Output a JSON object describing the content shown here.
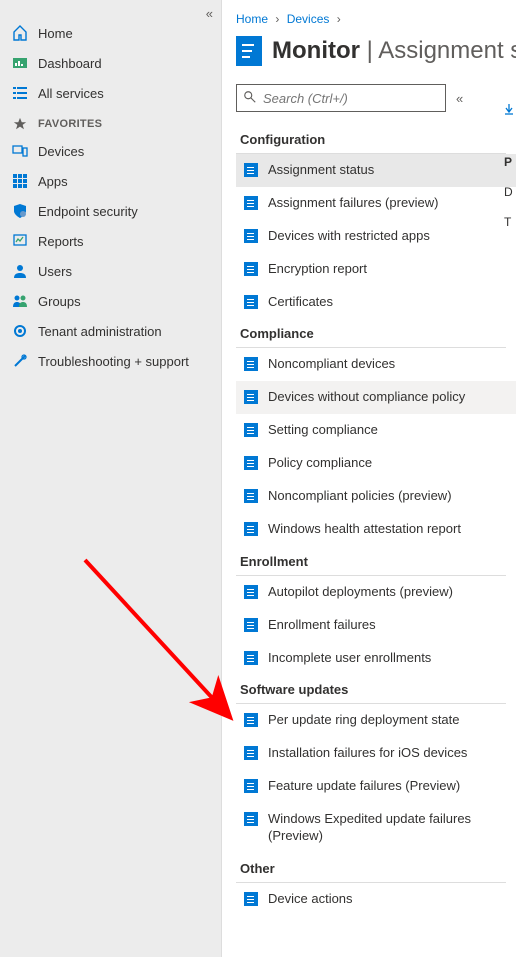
{
  "breadcrumb": {
    "home": "Home",
    "devices": "Devices"
  },
  "sidebar": {
    "items": [
      {
        "label": "Home"
      },
      {
        "label": "Dashboard"
      },
      {
        "label": "All services"
      }
    ],
    "favorites_label": "FAVORITES",
    "favorites": [
      {
        "label": "Devices"
      },
      {
        "label": "Apps"
      },
      {
        "label": "Endpoint security"
      },
      {
        "label": "Reports"
      },
      {
        "label": "Users"
      },
      {
        "label": "Groups"
      },
      {
        "label": "Tenant administration"
      },
      {
        "label": "Troubleshooting + support"
      }
    ]
  },
  "header": {
    "title": "Monitor",
    "separator": " | ",
    "subtitle": "Assignment s"
  },
  "search": {
    "placeholder": "Search (Ctrl+/)"
  },
  "sections": [
    {
      "title": "Configuration",
      "items": [
        "Assignment status",
        "Assignment failures (preview)",
        "Devices with restricted apps",
        "Encryption report",
        "Certificates"
      ]
    },
    {
      "title": "Compliance",
      "items": [
        "Noncompliant devices",
        "Devices without compliance policy",
        "Setting compliance",
        "Policy compliance",
        "Noncompliant policies (preview)",
        "Windows health attestation report"
      ]
    },
    {
      "title": "Enrollment",
      "items": [
        "Autopilot deployments (preview)",
        "Enrollment failures",
        "Incomplete user enrollments"
      ]
    },
    {
      "title": "Software updates",
      "items": [
        "Per update ring deployment state",
        "Installation failures for iOS devices",
        "Feature update failures (Preview)",
        "Windows Expedited update failures (Preview)"
      ]
    },
    {
      "title": "Other",
      "items": [
        "Device actions"
      ]
    }
  ],
  "peek": {
    "p": "P",
    "d": "D",
    "t": "T"
  }
}
